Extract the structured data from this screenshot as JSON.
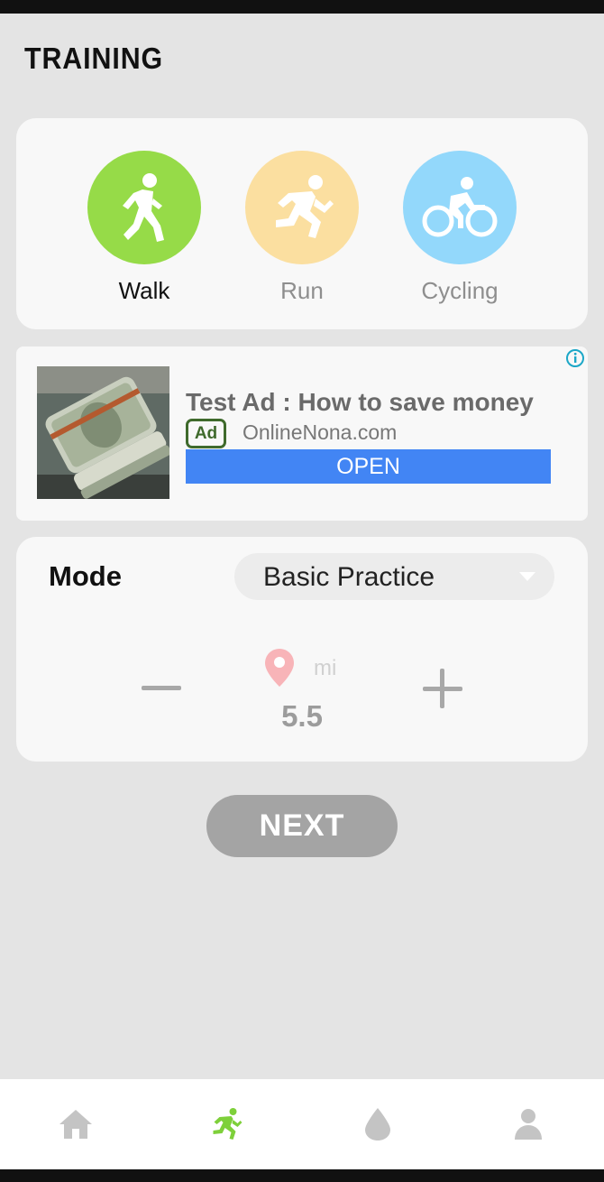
{
  "header": {
    "title": "TRAINING"
  },
  "activities": [
    {
      "label": "Walk",
      "color": "#96db48",
      "icon": "walk-icon",
      "selected": true
    },
    {
      "label": "Run",
      "color": "#fbdfa0",
      "icon": "run-icon",
      "selected": false
    },
    {
      "label": "Cycling",
      "color": "#93d8fb",
      "icon": "cycling-icon",
      "selected": false
    }
  ],
  "ad": {
    "title": "Test Ad : How to save money",
    "badge": "Ad",
    "domain": "OnlineNona.com",
    "cta": "OPEN",
    "image": "money-roll-image",
    "cta_color": "#4285f4"
  },
  "mode": {
    "label": "Mode",
    "selected": "Basic Practice",
    "unit": "mi",
    "distance": "5.5"
  },
  "actions": {
    "next": "NEXT"
  },
  "nav": {
    "items": [
      {
        "icon": "home-icon",
        "active": false
      },
      {
        "icon": "training-icon",
        "active": true
      },
      {
        "icon": "water-drop-icon",
        "active": false
      },
      {
        "icon": "profile-icon",
        "active": false
      }
    ],
    "active_color": "#7ed03a",
    "inactive_color": "#c4c4c4"
  }
}
